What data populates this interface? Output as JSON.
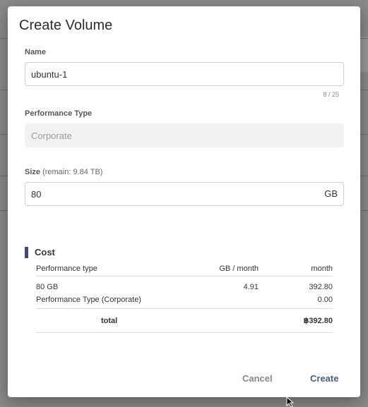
{
  "dialog": {
    "title": "Create Volume",
    "name_label": "Name",
    "name_value": "ubuntu-1",
    "name_counter": "8 / 25",
    "perf_label": "Performance Type",
    "perf_value": "Corporate",
    "size_label": "Size",
    "size_remain": "(remain: 9.84 TB)",
    "size_value": "80",
    "size_unit": "GB",
    "cancel_label": "Cancel",
    "create_label": "Create"
  },
  "cost": {
    "title": "Cost",
    "headers": [
      "Performance type",
      "GB / month",
      "month"
    ],
    "rows": [
      {
        "item": "80 GB",
        "rate": "4.91",
        "month": "392.80"
      },
      {
        "item": "Performance Type (Corporate)",
        "rate": "",
        "month": "0.00"
      }
    ],
    "total_label": "total",
    "total_value": "฿392.80"
  },
  "colors": {
    "accent": "#3d4a7a",
    "create_button": "#4a5a8a",
    "cancel_button": "#888888",
    "overlay": "#7f7f7f"
  }
}
